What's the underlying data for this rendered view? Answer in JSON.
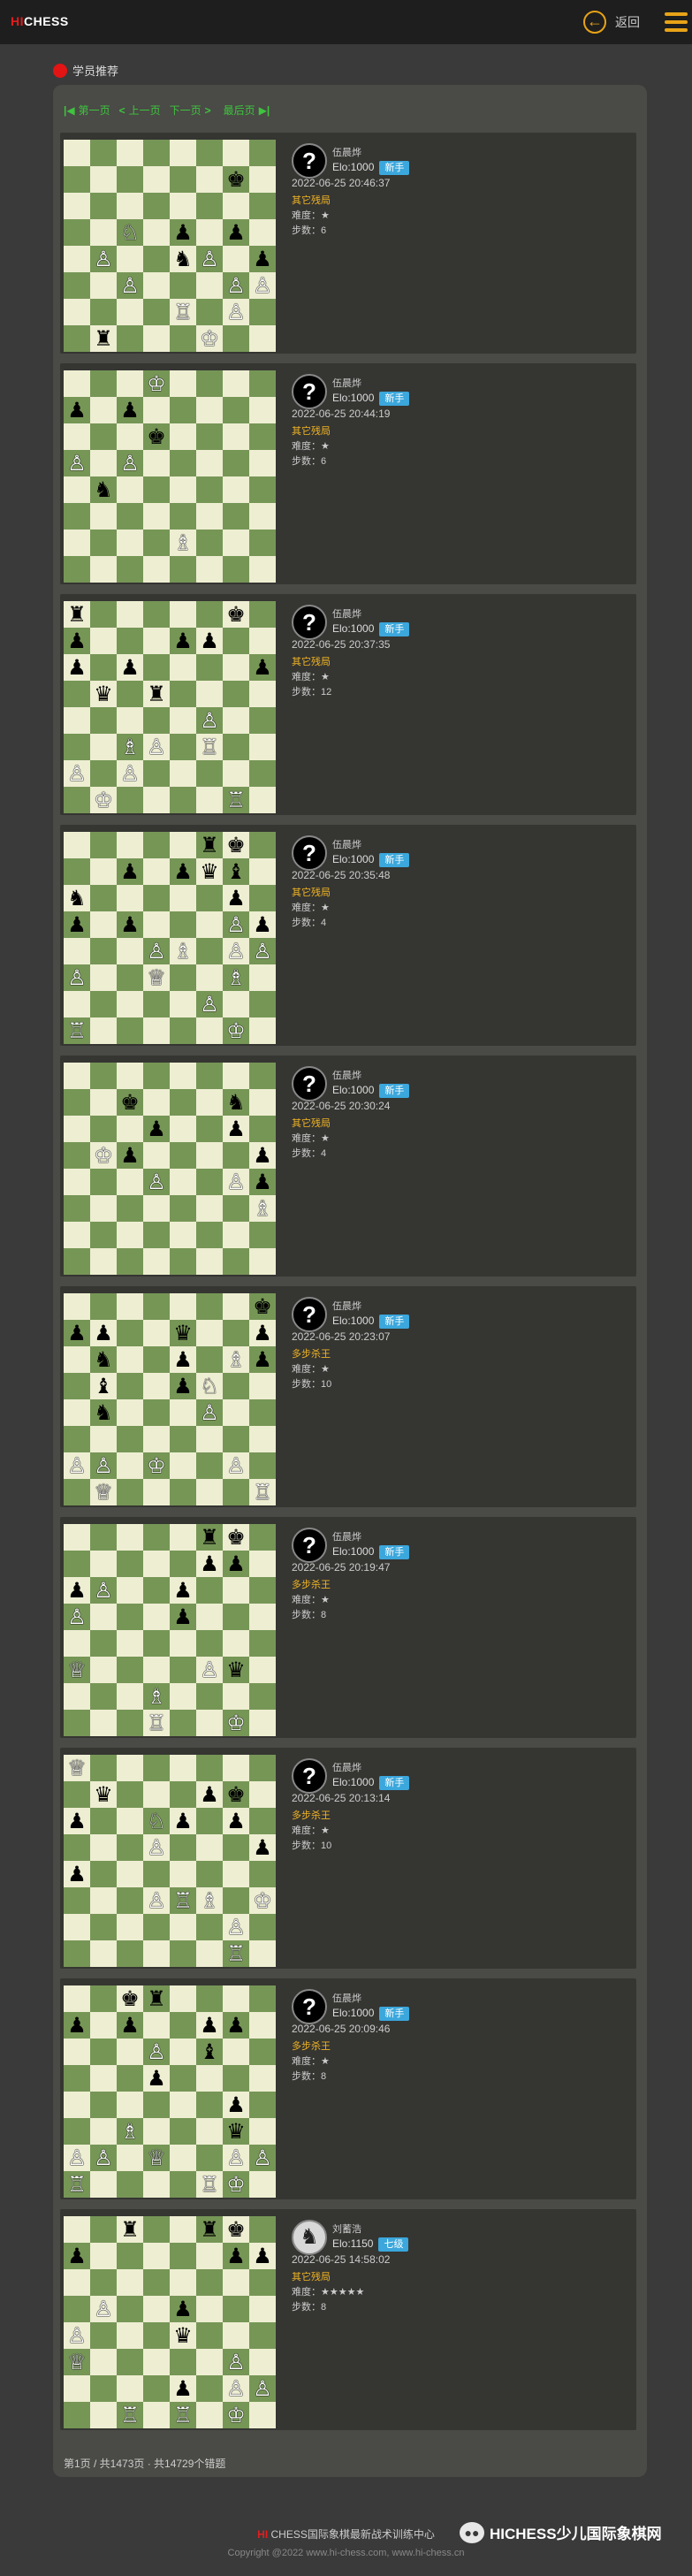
{
  "header": {
    "logo_hi": "HI",
    "logo_rest": "CHESS",
    "back_label": "返回"
  },
  "section_title": "学员推荐",
  "pager": {
    "first": "第一页",
    "prev": "上一页",
    "next": "下一页",
    "last": "最后页"
  },
  "puzzles": [
    {
      "author": "伍晨烨",
      "elo": "Elo:1000",
      "level": "新手",
      "date": "2022-06-25 20:46:37",
      "category": "其它残局",
      "difficulty": "难度：★",
      "steps": "步数：6",
      "fen": "8/6k1/8/2N1p1p1/1P2nP1p/2P3PP/4R1P1/1r3K2"
    },
    {
      "author": "伍晨烨",
      "elo": "Elo:1000",
      "level": "新手",
      "date": "2022-06-25 20:44:19",
      "category": "其它残局",
      "difficulty": "难度：★",
      "steps": "步数：6",
      "fen": "3K4/p1p5/3k4/P1P5/1n6/8/4B3/8"
    },
    {
      "author": "伍晨烨",
      "elo": "Elo:1000",
      "level": "新手",
      "date": "2022-06-25 20:37:35",
      "category": "其它残局",
      "difficulty": "难度：★",
      "steps": "步数：12",
      "fen": "r5k1/p3pp2/p1p4p/1q1r4/5P2/2BP1R2/P1P5/1K4R1"
    },
    {
      "author": "伍晨烨",
      "elo": "Elo:1000",
      "level": "新手",
      "date": "2022-06-25 20:35:48",
      "category": "其它残局",
      "difficulty": "难度：★",
      "steps": "步数：4",
      "fen": "5rk1/2p1pqb1/n5p1/p1p3Pp/3PB1PP/P2Q2B1/5P2/R5K1"
    },
    {
      "author": "伍晨烨",
      "elo": "Elo:1000",
      "level": "新手",
      "date": "2022-06-25 20:30:24",
      "category": "其它残局",
      "difficulty": "难度：★",
      "steps": "步数：4",
      "fen": "8/2k3n1/3p2p1/1Kp4p/3P2Pp/7B/8/8"
    },
    {
      "author": "伍晨烨",
      "elo": "Elo:1000",
      "level": "新手",
      "date": "2022-06-25 20:23:07",
      "category": "多步杀王",
      "difficulty": "难度：★",
      "steps": "步数：10",
      "fen": "7k/pp2q2p/1n2p1Bp/1b2pN2/1n3P2/8/PP1K2P1/1Q5R"
    },
    {
      "author": "伍晨烨",
      "elo": "Elo:1000",
      "level": "新手",
      "date": "2022-06-25 20:19:47",
      "category": "多步杀王",
      "difficulty": "难度：★",
      "steps": "步数：8",
      "fen": "5rk1/5pp1/pP2p3/P3p3/8/Q4Pq1/3B4/3R2K1"
    },
    {
      "author": "伍晨烨",
      "elo": "Elo:1000",
      "level": "新手",
      "date": "2022-06-25 20:13:14",
      "category": "多步杀王",
      "difficulty": "难度：★",
      "steps": "步数：10",
      "fen": "Q7/1q3pk1/p2Np1p1/3P3p/p7/3PRB1K/6P1/6R1"
    },
    {
      "author": "伍晨烨",
      "elo": "Elo:1000",
      "level": "新手",
      "date": "2022-06-25 20:09:46",
      "category": "多步杀王",
      "difficulty": "难度：★",
      "steps": "步数：8",
      "fen": "2kr4/p1p2pp1/3P1b2/3p4/6p1/2B3q1/PP1Q2PP/R4RK1"
    },
    {
      "author": "刘蓄浩",
      "elo": "Elo:1150",
      "level": "七级",
      "date": "2022-06-25 14:58:02",
      "category": "其它残局",
      "difficulty": "难度：★★★★★",
      "steps": "步数：8",
      "fen": "2r2rk1/p5pp/8/1P2p3/P3q3/Q5P1/4p1PP/2R1R1K1"
    }
  ],
  "summary": "第1页 / 共1473页 · 共14729个错题",
  "footer": {
    "hi": "HI",
    "line1_rest": " CHESS国际象棋最新战术训练中心",
    "copyright": "Copyright @2022 www.hi-chess.com, www.hi-chess.cn"
  },
  "watermark": "HICHESS少儿国际象棋网",
  "colors": {
    "accent": "#e8a317",
    "pager_green": "#3ec43e",
    "badge_blue": "#3ba7dc",
    "category_gold": "#f0b424"
  }
}
